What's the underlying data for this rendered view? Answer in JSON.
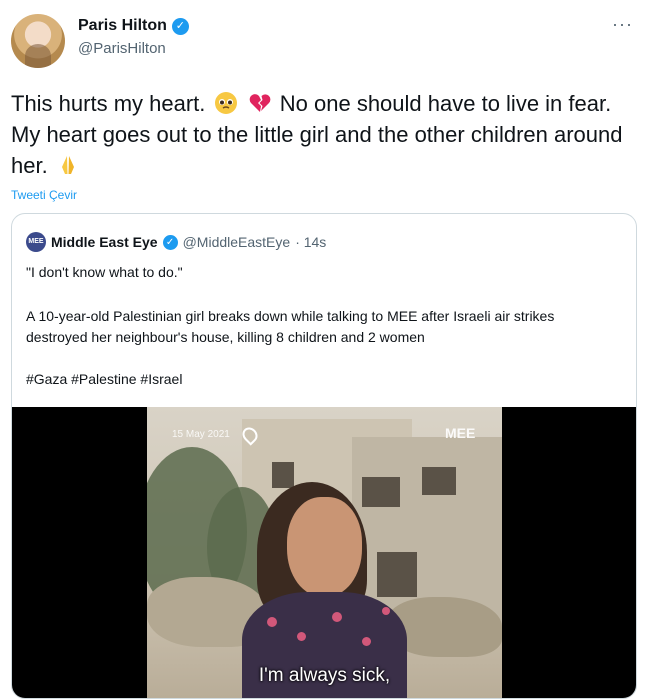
{
  "author": {
    "name": "Paris Hilton",
    "handle": "@ParisHilton",
    "more_icon": "more-horizontal-icon"
  },
  "tweet": {
    "text_part1": "This hurts my heart.",
    "text_part2": "No one should have to live in fear. My heart goes out to the little girl and the other children around her.",
    "translate_label": "Tweeti Çevir"
  },
  "quoted": {
    "name": "Middle East Eye",
    "handle": "@MiddleEastEye",
    "time": "· 14s",
    "logo_text": "MEE",
    "line1": "\"I don't know what to do.\"",
    "line2": "A 10-year-old Palestinian girl breaks down while talking to MEE after Israeli air strikes destroyed her neighbour's house, killing 8 children and 2 women",
    "hashtags": "#Gaza #Palestine #Israel",
    "video": {
      "date_stamp": "15 May 2021",
      "watermark": "MEE",
      "subtitle": "I'm always sick,"
    }
  },
  "colors": {
    "accent": "#1d9bf0",
    "text": "#0f1419",
    "secondary": "#536471"
  }
}
